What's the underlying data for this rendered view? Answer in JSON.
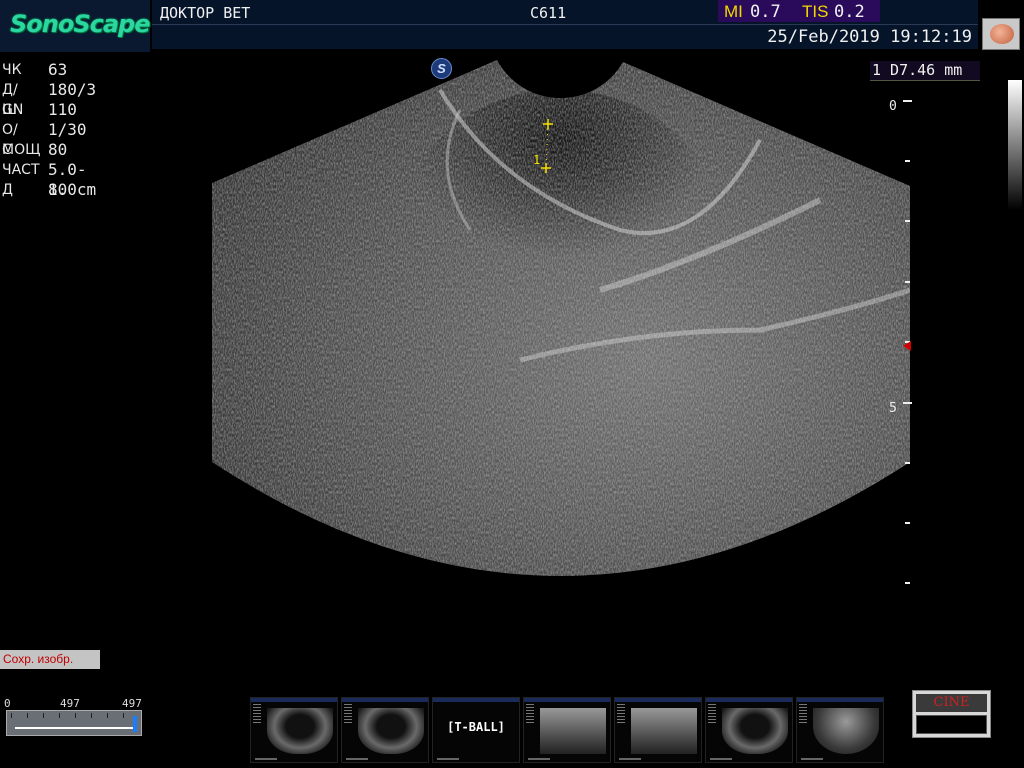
{
  "header": {
    "brand": "SonoScape",
    "patient_name": "ДОКТОР ВЕТ",
    "probe": "C611",
    "mi_label": "MI",
    "mi_value": "0.7",
    "tis_label": "TIS",
    "tis_value": "0.2",
    "datetime": "25/Feb/2019 19:12:19",
    "organ_preset_icon": "brain-icon"
  },
  "params": [
    {
      "label": "ЧК",
      "value": " 63"
    },
    {
      "label": "Д/Ш",
      "value": "180/3"
    },
    {
      "label": "GN",
      "value": "110"
    },
    {
      "label": "О/С",
      "value": "1/30"
    },
    {
      "label": "МОЩ",
      "value": "80"
    },
    {
      "label": "ЧАСТ",
      "value": "5.0-10"
    },
    {
      "label": "Д",
      "value": "8.0cm"
    }
  ],
  "measurement": {
    "result": "1 D7.46 mm",
    "marker_label": "1"
  },
  "depth_scale": {
    "labels": [
      "0",
      "5"
    ]
  },
  "buttons": {
    "save_image": "Сохр. изобр."
  },
  "cine_slider": {
    "min": "0",
    "current": "497",
    "max": "497"
  },
  "thumbnails": {
    "label": "[T-BALL]"
  },
  "cine_panel": {
    "label": "CINE"
  },
  "colors": {
    "brand": "#2bd6a0",
    "mi_accent": "#f5d800",
    "caliper": "#f5e000",
    "focus_marker": "#d00000",
    "save_text": "#c00000"
  }
}
